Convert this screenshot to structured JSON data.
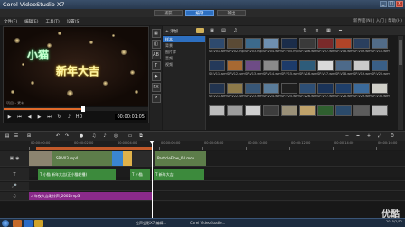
{
  "window": {
    "title": "Corel VideoStudio X7"
  },
  "tabs": [
    {
      "label": "捕获",
      "active": false
    },
    {
      "label": "编辑",
      "active": true
    },
    {
      "label": "输出",
      "active": false
    }
  ],
  "menu": [
    "文件(F)",
    "编辑(E)",
    "工具(T)",
    "设置(S)"
  ],
  "topright": "新界面(N) | 入门 | 帮助(H)",
  "preview": {
    "text1": "小猫",
    "text2": "新年大吉",
    "modes": [
      "项目",
      "素材"
    ],
    "timecode": "00:00:01:05",
    "progress": 0.55
  },
  "library": {
    "add_label": "+ 添加",
    "nav": [
      {
        "label": "样本",
        "selected": true
      },
      {
        "label": "背景",
        "selected": false
      },
      {
        "label": "图片库",
        "selected": false
      },
      {
        "label": "音频",
        "selected": false
      },
      {
        "label": "视频",
        "selected": false
      }
    ],
    "thumbs": [
      {
        "cap": "SP-V01.wmv",
        "color": "#2e4a6e"
      },
      {
        "cap": "SP-V02.mp4",
        "color": "#5a4a35"
      },
      {
        "cap": "SP-V03.mp4",
        "color": "#3c6a8c"
      },
      {
        "cap": "SP-V04.wmv",
        "color": "#6e8fb0"
      },
      {
        "cap": "SP-V05.mp4",
        "color": "#1b2d4a"
      },
      {
        "cap": "SP-V06.wmv",
        "color": "#3a3a3a"
      },
      {
        "cap": "SP-V07.wmv",
        "color": "#7a2a2a"
      },
      {
        "cap": "SP-V08.wmv",
        "color": "#b04428"
      },
      {
        "cap": "SP-V09.wmv",
        "color": "#2a3f5e"
      },
      {
        "cap": "SP-V10.wmv",
        "color": "#516b87"
      },
      {
        "cap": "SP-V11.wmv",
        "color": "#24395a"
      },
      {
        "cap": "SP-V12.wmv",
        "color": "#a76932"
      },
      {
        "cap": "SP-V13.wmv",
        "color": "#6e4c86"
      },
      {
        "cap": "SP-V14.wmv",
        "color": "#8a8a8a"
      },
      {
        "cap": "SP-V15.wmv",
        "color": "#1d3b6a"
      },
      {
        "cap": "SP-V16.wmv",
        "color": "#2e5c7a"
      },
      {
        "cap": "SP-V17.wmv",
        "color": "#d9d9d9"
      },
      {
        "cap": "SP-V18.wmv",
        "color": "#4d6a8a"
      },
      {
        "cap": "SP-V19.wmv",
        "color": "#c9c9c9"
      },
      {
        "cap": "SP-V20.wmv",
        "color": "#3a5f86"
      },
      {
        "cap": "SP-V21.wmv",
        "color": "#22344f"
      },
      {
        "cap": "SP-V22.wmv",
        "color": "#8d7a4a"
      },
      {
        "cap": "SP-V23.wmv",
        "color": "#385777"
      },
      {
        "cap": "SP-V24.wmv",
        "color": "#5a7c9a"
      },
      {
        "cap": "SP-V25.wmv",
        "color": "#1f1f1f"
      },
      {
        "cap": "SP-V26.wmv",
        "color": "#2d4e74"
      },
      {
        "cap": "SP-V27.wmv",
        "color": "#1a3358"
      },
      {
        "cap": "SP-V28.wmv",
        "color": "#1f3f6a"
      },
      {
        "cap": "SP-V29.wmv",
        "color": "#3b6a9a"
      },
      {
        "cap": "SP-V30.wmv",
        "color": "#d0cfc8"
      },
      {
        "cap": "",
        "color": "#bcbcbc"
      },
      {
        "cap": "",
        "color": "#9c9c9c"
      },
      {
        "cap": "",
        "color": "#cfcfcf"
      },
      {
        "cap": "",
        "color": "#3d3d3d"
      },
      {
        "cap": "",
        "color": "#9a9078"
      },
      {
        "cap": "",
        "color": "#bfa26a"
      },
      {
        "cap": "",
        "color": "#2f5f2f"
      },
      {
        "cap": "",
        "color": "#2b4a6a"
      },
      {
        "cap": "",
        "color": "#5c5c5c"
      },
      {
        "cap": "",
        "color": "#bcbcbc"
      }
    ]
  },
  "timeline": {
    "ruler": [
      "00:00:00:00",
      "00:00:02:00",
      "00:00:04:00",
      "00:00:06:00",
      "00:00:08:00",
      "00:00:10:00",
      "00:00:12:00",
      "00:00:14:00",
      "00:00:16:00"
    ],
    "video_clips": [
      {
        "label": "SP-V03.mp4",
        "color": "#5d7d4a"
      },
      {
        "label": "",
        "color": "#3a86d0"
      },
      {
        "label": "",
        "color": "#e0b24a"
      },
      {
        "label": "",
        "color": "#2b2b2b"
      },
      {
        "label": "ParticleFlow_04.mov",
        "color": "#5d7d4a"
      }
    ],
    "title_clips": [
      {
        "label": "T 小猫 新年大吉(正小猫轮播)",
        "color": "#3c8a3c"
      },
      {
        "label": "T 小猫",
        "color": "#3c8a3c"
      },
      {
        "label": "T 新年大吉",
        "color": "#3c8a3c"
      }
    ],
    "music_clip": {
      "label": "♪ 年夜大吉彩铃声_2002.mp3",
      "color": "#8a2a8a"
    }
  },
  "taskbar": {
    "items": [
      "会声会影X7 编辑...",
      "Corel VideoStudio..."
    ],
    "clock": "2015/2/12"
  },
  "watermark": "优酷",
  "colors": {
    "accent": "#2d6fc0",
    "playhead": "#ffffff"
  }
}
